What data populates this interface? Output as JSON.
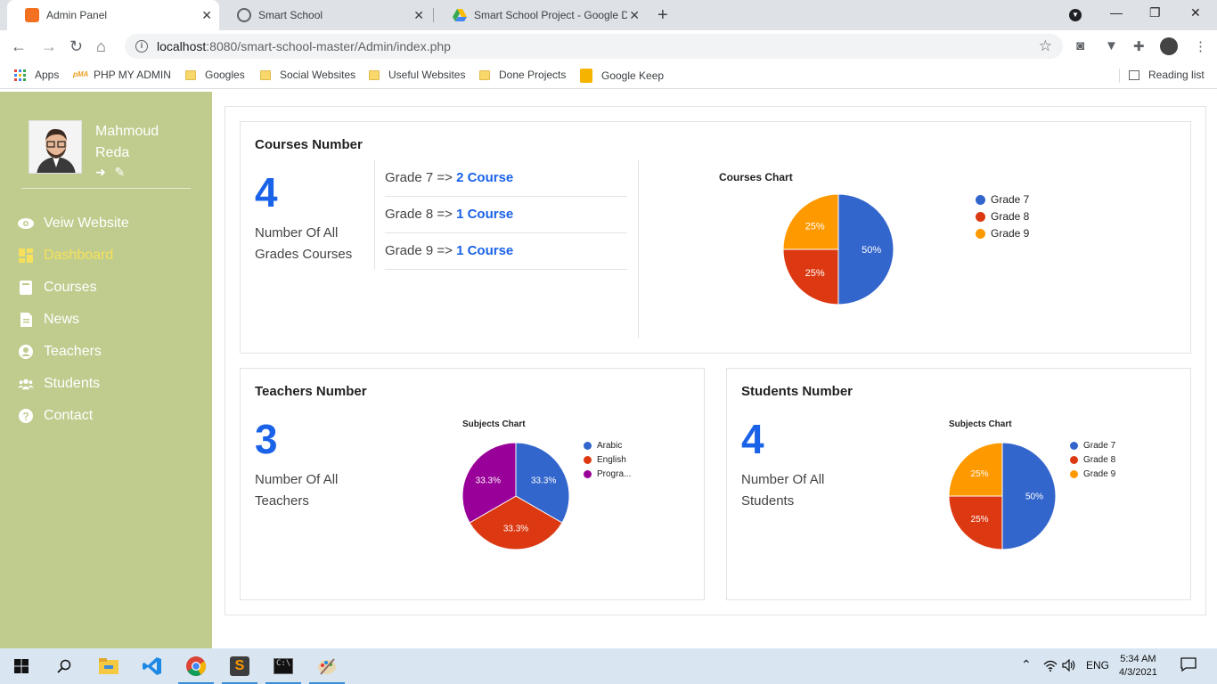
{
  "browser": {
    "tabs": [
      {
        "title": "Admin Panel",
        "icon": "xampp-icon"
      },
      {
        "title": "Smart School",
        "icon": "globe-icon"
      },
      {
        "title": "Smart School Project - Google Dr",
        "icon": "google-drive-icon"
      }
    ],
    "url_host": "localhost",
    "url_path": ":8080/smart-school-master/Admin/index.php",
    "bookmarks": [
      {
        "label": "Apps"
      },
      {
        "label": "PHP MY ADMIN"
      },
      {
        "label": "Googles"
      },
      {
        "label": "Social Websites"
      },
      {
        "label": "Useful Websites"
      },
      {
        "label": "Done Projects"
      },
      {
        "label": "Google Keep"
      }
    ],
    "reading_list": "Reading list"
  },
  "sidebar": {
    "user_first": "Mahmoud",
    "user_last": "Reda",
    "items": [
      {
        "label": "Veiw Website",
        "icon": "eye-icon"
      },
      {
        "label": "Dashboard",
        "icon": "dashboard-icon"
      },
      {
        "label": "Courses",
        "icon": "book-icon"
      },
      {
        "label": "News",
        "icon": "document-icon"
      },
      {
        "label": "Teachers",
        "icon": "user-circle-icon"
      },
      {
        "label": "Students",
        "icon": "users-icon"
      },
      {
        "label": "Contact",
        "icon": "question-icon"
      }
    ]
  },
  "courses": {
    "title": "Courses Number",
    "count": "4",
    "desc_line1": "Number Of All",
    "desc_line2": "Grades Courses",
    "grades": [
      {
        "label": "Grade 7 => ",
        "count": "2 Course"
      },
      {
        "label": "Grade 8 => ",
        "count": "1 Course"
      },
      {
        "label": "Grade 9 => ",
        "count": "1 Course"
      }
    ]
  },
  "teachers": {
    "title": "Teachers Number",
    "count": "3",
    "desc_line1": "Number Of All",
    "desc_line2": "Teachers"
  },
  "students": {
    "title": "Students Number",
    "count": "4",
    "desc_line1": "Number Of All",
    "desc_line2": "Students"
  },
  "chart_data": [
    {
      "type": "pie",
      "title": "Courses Chart",
      "labels": [
        "Grade 7",
        "Grade 8",
        "Grade 9"
      ],
      "values": [
        2,
        1,
        1
      ],
      "slice_labels": [
        "50%",
        "25%",
        "25%"
      ],
      "colors": [
        "#3366cc",
        "#dc3912",
        "#ff9900"
      ],
      "legend": "right"
    },
    {
      "type": "pie",
      "title": "Subjects Chart",
      "labels": [
        "Arabic",
        "English",
        "Progra..."
      ],
      "values": [
        1,
        1,
        1
      ],
      "slice_labels": [
        "33.3%",
        "33.3%",
        "33.3%"
      ],
      "colors": [
        "#3366cc",
        "#dc3912",
        "#990099"
      ],
      "legend": "right"
    },
    {
      "type": "pie",
      "title": "Subjects Chart",
      "labels": [
        "Grade 7",
        "Grade 8",
        "Grade 9"
      ],
      "values": [
        2,
        1,
        1
      ],
      "slice_labels": [
        "50%",
        "25%",
        "25%"
      ],
      "colors": [
        "#3366cc",
        "#dc3912",
        "#ff9900"
      ],
      "legend": "right"
    }
  ],
  "taskbar": {
    "lang": "ENG",
    "time": "5:34 AM",
    "date": "4/3/2021"
  }
}
